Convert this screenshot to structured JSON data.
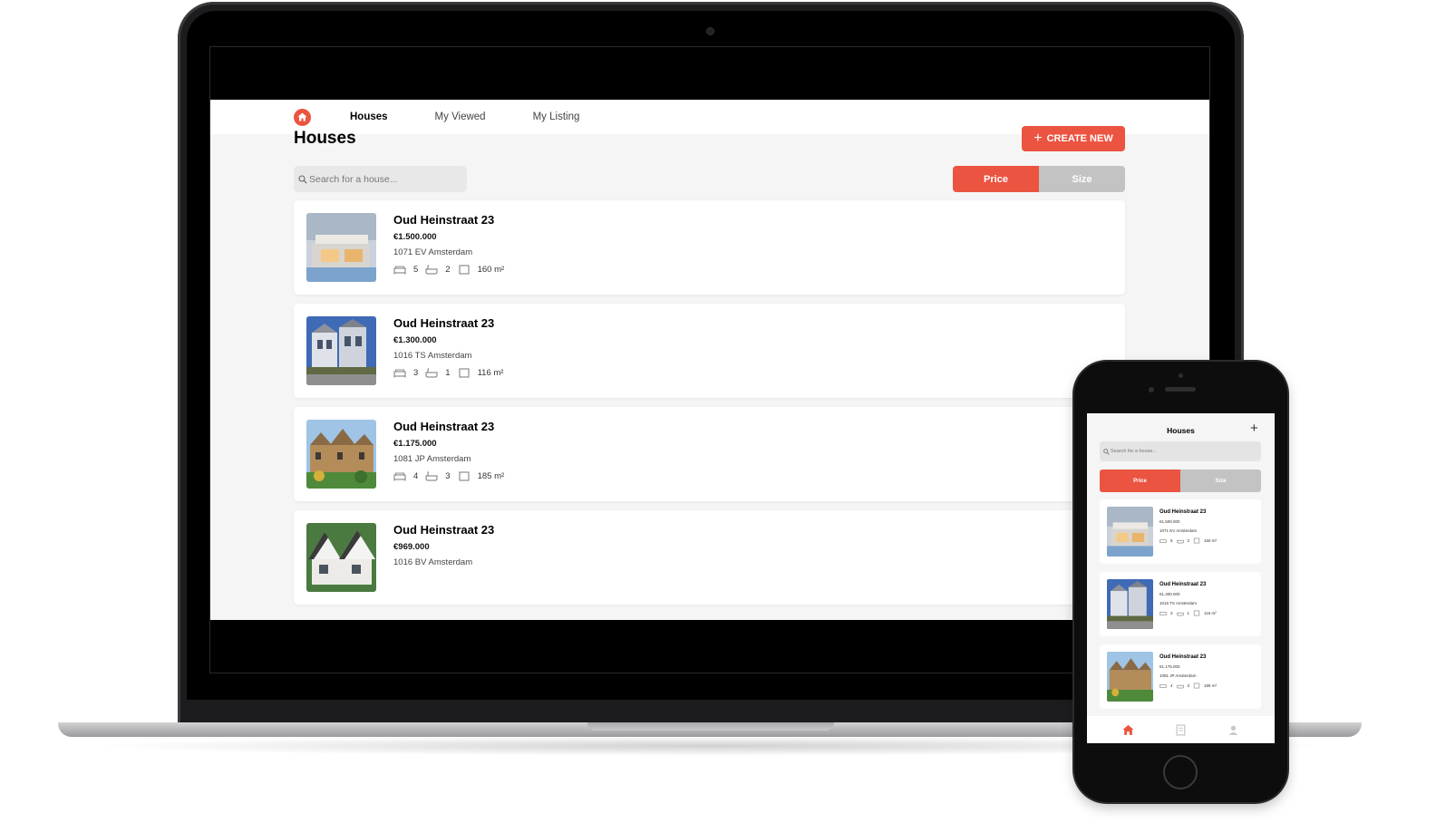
{
  "desktop": {
    "nav": {
      "items": [
        {
          "label": "Houses",
          "active": true
        },
        {
          "label": "My Viewed",
          "active": false
        },
        {
          "label": "My Listing",
          "active": false
        }
      ]
    },
    "page_title": "Houses",
    "create_button": "CREATE NEW",
    "search_placeholder": "Search for a house...",
    "sort": {
      "price": "Price",
      "size": "Size",
      "active": "Price"
    },
    "listings": [
      {
        "street": "Oud Heinstraat 23",
        "price": "€1.500.000",
        "zip": "1071 EV Amsterdam",
        "beds": "5",
        "baths": "2",
        "area": "160 m²",
        "image": "modern-house"
      },
      {
        "street": "Oud Heinstraat 23",
        "price": "€1.300.000",
        "zip": "1016 TS Amsterdam",
        "beds": "3",
        "baths": "1",
        "area": "116 m²",
        "image": "townhouse"
      },
      {
        "street": "Oud Heinstraat 23",
        "price": "€1.175.000",
        "zip": "1081 JP Amsterdam",
        "beds": "4",
        "baths": "3",
        "area": "185 m²",
        "image": "manor"
      },
      {
        "street": "Oud Heinstraat 23",
        "price": "€969.000",
        "zip": "1016 BV Amsterdam",
        "beds": "",
        "baths": "",
        "area": "",
        "image": "cottage"
      }
    ]
  },
  "mobile": {
    "title": "Houses",
    "search_placeholder": "Search for a house...",
    "sort": {
      "price": "Price",
      "size": "Size"
    },
    "listings": [
      {
        "street": "Oud Heinstraat 23",
        "price": "€1.500.000",
        "zip": "1071 EV Amsterdam",
        "beds": "5",
        "baths": "2",
        "area": "160 m²"
      },
      {
        "street": "Oud Heinstraat 23",
        "price": "€1.300.000",
        "zip": "1016 TS Amsterdam",
        "beds": "3",
        "baths": "1",
        "area": "116 m²"
      },
      {
        "street": "Oud Heinstraat 23",
        "price": "€1.175.000",
        "zip": "1081 JP Amsterdam",
        "beds": "4",
        "baths": "3",
        "area": "185 m²"
      }
    ],
    "tabbar": [
      "home-icon",
      "listing-icon",
      "profile-icon"
    ]
  },
  "colors": {
    "accent": "#eb5440",
    "inactive_toggle": "#c3c3c3",
    "background": "#f5f5f5"
  }
}
